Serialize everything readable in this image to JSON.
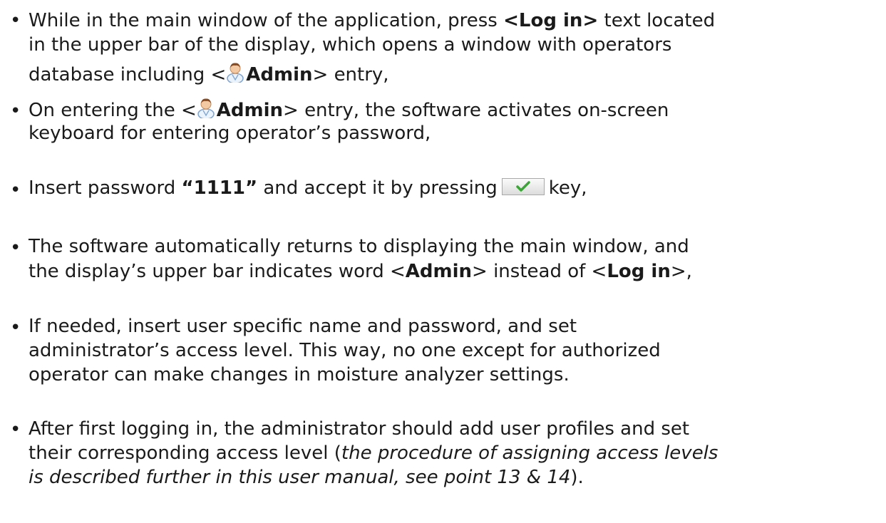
{
  "bullets": [
    {
      "l1_a": "While in the main window of the application, press ",
      "l1_b": "<",
      "l1_c": "Log in",
      "l1_d": ">",
      "l1_e": " text located",
      "l2": "in the upper bar of the display, which opens a window with operators",
      "l3_a": "database including <",
      "l3_b": "Admin",
      "l3_c": "> entry,",
      "icon": "user-icon"
    },
    {
      "l1_a": "On entering the <",
      "l1_b": "Admin",
      "l1_c": "> entry, the software activates on-screen",
      "l2": "keyboard for entering operator’s password,",
      "icon": "user-icon"
    },
    {
      "l1_a": "Insert password ",
      "l1_b": "“1111”",
      "l1_c": " and accept it by pressing",
      "l1_d": "key,",
      "icon": "checkmark-key-icon",
      "check_color": "#3aa635"
    },
    {
      "l1": "The software automatically returns to displaying the main window, and",
      "l2_a": "the display’s upper bar indicates word <",
      "l2_b": "Admin",
      "l2_c": "> instead of <",
      "l2_d": "Log in",
      "l2_e": ">,"
    },
    {
      "l1": "If needed, insert user specific name and password, and set",
      "l2": "administrator’s access level. This way, no one except for authorized",
      "l3": "operator can make changes in moisture analyzer settings."
    },
    {
      "l1": "After first logging in, the administrator should add user profiles and set",
      "l2_a": "their corresponding access level (",
      "l2_b": "the procedure of assigning access levels",
      "l3_a": "is described further in this user manual, see point 13 & 14",
      "l3_b": ")."
    }
  ]
}
